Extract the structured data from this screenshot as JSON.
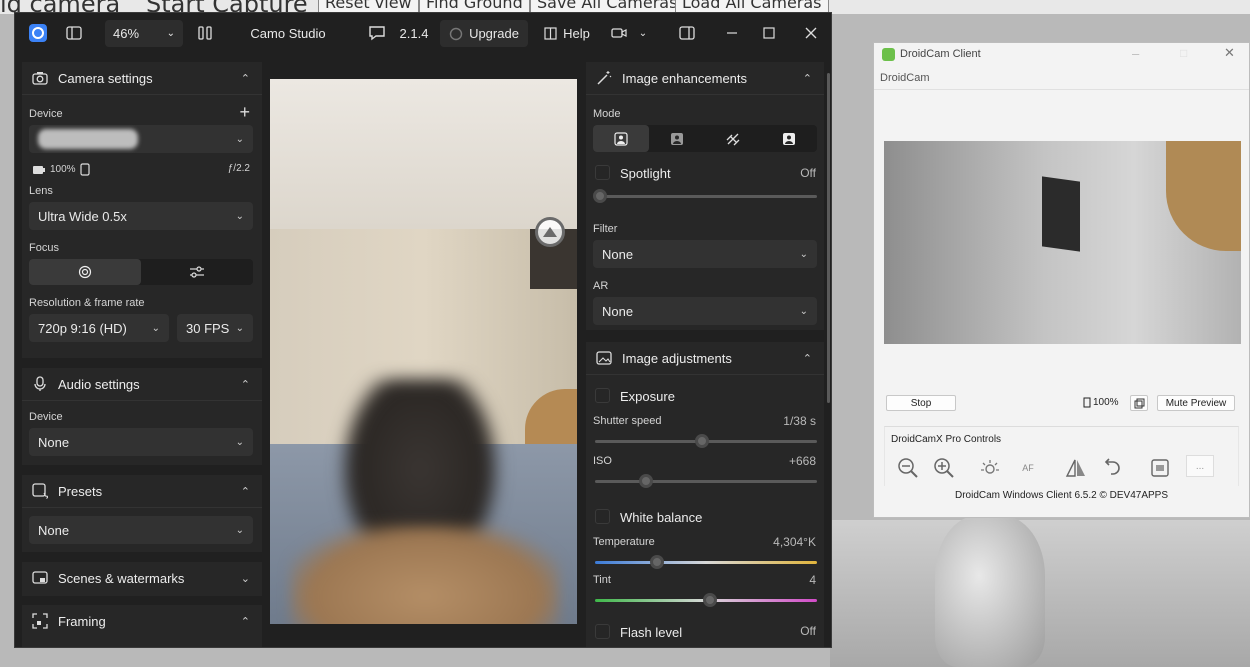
{
  "background_app": {
    "toolbar": [
      "id camera",
      "Start Capture",
      "Reset view",
      "Find Ground",
      "Save All Cameras",
      "Load All Cameras"
    ]
  },
  "camo": {
    "title": "Camo Studio",
    "zoom": "46%",
    "version": "2.1.4",
    "upgrade_label": "Upgrade",
    "help_label": "Help",
    "left": {
      "camera_settings": {
        "title": "Camera settings",
        "device_label": "Device",
        "battery": "100%",
        "aperture": "ƒ/2.2",
        "lens_label": "Lens",
        "lens_value": "Ultra Wide 0.5x",
        "focus_label": "Focus",
        "resolution_label": "Resolution & frame rate",
        "resolution_value": "720p 9:16 (HD)",
        "fps_value": "30 FPS"
      },
      "audio_settings": {
        "title": "Audio settings",
        "device_label": "Device",
        "device_value": "None"
      },
      "presets": {
        "title": "Presets",
        "value": "None"
      },
      "scenes": {
        "title": "Scenes & watermarks"
      },
      "framing": {
        "title": "Framing"
      }
    },
    "right": {
      "image_enhancements": {
        "title": "Image enhancements",
        "mode_label": "Mode",
        "spotlight_label": "Spotlight",
        "spotlight_value": "Off",
        "filter_label": "Filter",
        "filter_value": "None",
        "ar_label": "AR",
        "ar_value": "None"
      },
      "image_adjustments": {
        "title": "Image adjustments",
        "exposure_label": "Exposure",
        "shutter_label": "Shutter speed",
        "shutter_value": "1/38 s",
        "shutter_level": 0.48,
        "iso_label": "ISO",
        "iso_value": "+668",
        "iso_level": 0.23,
        "white_balance_label": "White balance",
        "temperature_label": "Temperature",
        "temperature_value": "4,304°K",
        "temperature_level": 0.28,
        "tint_label": "Tint",
        "tint_value": "4",
        "tint_level": 0.52,
        "flash_label": "Flash level",
        "flash_value": "Off"
      }
    }
  },
  "droidcam": {
    "window_title": "DroidCam Client",
    "menu_label": "DroidCam",
    "stop_label": "Stop",
    "battery": "100%",
    "mute_label": "Mute Preview",
    "pro_title": "DroidCamX Pro Controls",
    "af_label": "AF",
    "more_label": "...",
    "footer": "DroidCam Windows Client 6.5.2 © DEV47APPS"
  },
  "colors": {
    "camo_bg": "#202020",
    "panel_bg": "#272727",
    "droid_bg": "#f3f3f3"
  }
}
